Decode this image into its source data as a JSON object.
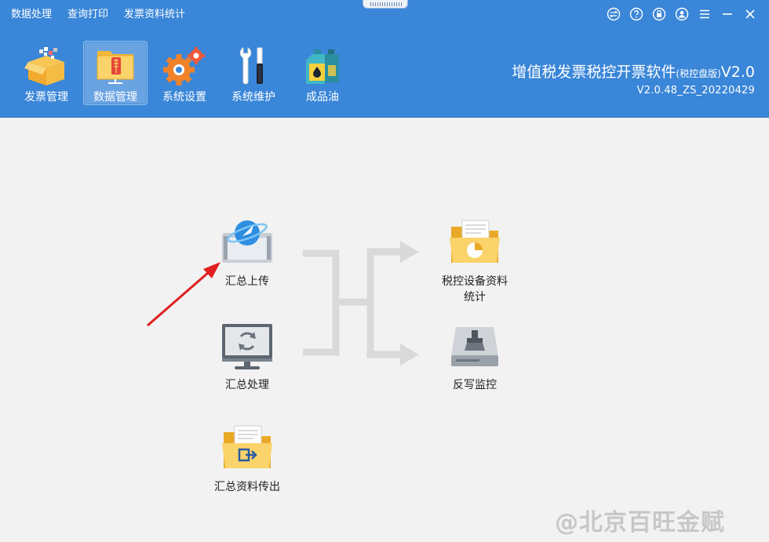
{
  "top_menu": [
    "数据处理",
    "查询打印",
    "发票资料统计"
  ],
  "toolbar": [
    {
      "label": "发票管理",
      "icon": "invoice-box-icon"
    },
    {
      "label": "数据管理",
      "icon": "data-folder-icon",
      "active": true
    },
    {
      "label": "系统设置",
      "icon": "gears-icon"
    },
    {
      "label": "系统维护",
      "icon": "wrench-screwdriver-icon"
    },
    {
      "label": "成品油",
      "icon": "oil-can-icon"
    }
  ],
  "brand": {
    "title": "增值税发票税控开票软件",
    "edition": "(税控盘版)",
    "title_suffix": "V2.0",
    "version": "V2.0.48_ZS_20220429"
  },
  "functions": {
    "upload": {
      "label": "汇总上传",
      "icon": "upload-globe-icon"
    },
    "process": {
      "label": "汇总处理",
      "icon": "monitor-refresh-icon"
    },
    "export": {
      "label": "汇总资料传出",
      "icon": "folder-export-icon"
    },
    "device_stats": {
      "label": "税控设备资料统计",
      "icon": "folder-chart-icon"
    },
    "writeback": {
      "label": "反写监控",
      "icon": "disk-broom-icon"
    }
  },
  "watermark": "@北京百旺金赋",
  "colors": {
    "header": "#3a86d8",
    "accent_arrow": "#e02020",
    "flow_arrow": "#d9d9d9"
  }
}
